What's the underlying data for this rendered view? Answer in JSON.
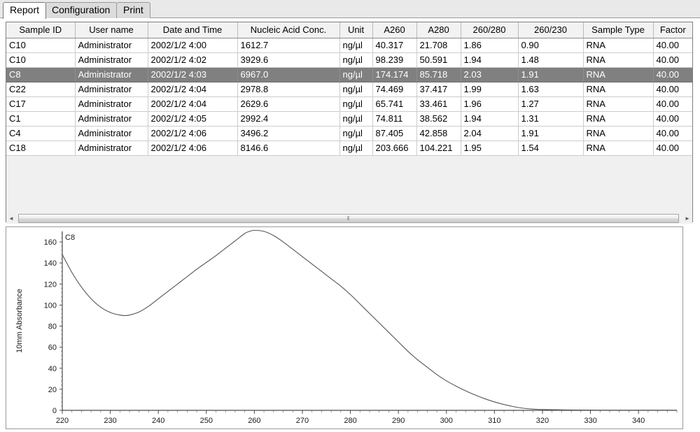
{
  "window": {
    "tabs": [
      {
        "id": "report",
        "label": "Report",
        "active": true
      },
      {
        "id": "configuration",
        "label": "Configuration",
        "active": false
      },
      {
        "id": "print",
        "label": "Print",
        "active": false
      }
    ]
  },
  "table": {
    "columns": [
      "Sample ID",
      "User name",
      "Date and Time",
      "Nucleic Acid Conc.",
      "Unit",
      "A260",
      "A280",
      "260/280",
      "260/230",
      "Sample Type",
      "Factor"
    ],
    "rows": [
      {
        "selected": false,
        "cells": [
          "C10",
          "Administrator",
          "2002/1/2 4:00",
          "1612.7",
          "ng/µl",
          "40.317",
          "21.708",
          "1.86",
          "0.90",
          "RNA",
          "40.00"
        ]
      },
      {
        "selected": false,
        "cells": [
          "C10",
          "Administrator",
          "2002/1/2 4:02",
          "3929.6",
          "ng/µl",
          "98.239",
          "50.591",
          "1.94",
          "1.48",
          "RNA",
          "40.00"
        ]
      },
      {
        "selected": true,
        "cells": [
          "C8",
          "Administrator",
          "2002/1/2 4:03",
          "6967.0",
          "ng/µl",
          "174.174",
          "85.718",
          "2.03",
          "1.91",
          "RNA",
          "40.00"
        ]
      },
      {
        "selected": false,
        "cells": [
          "C22",
          "Administrator",
          "2002/1/2 4:04",
          "2978.8",
          "ng/µl",
          "74.469",
          "37.417",
          "1.99",
          "1.63",
          "RNA",
          "40.00"
        ]
      },
      {
        "selected": false,
        "cells": [
          "C17",
          "Administrator",
          "2002/1/2 4:04",
          "2629.6",
          "ng/µl",
          "65.741",
          "33.461",
          "1.96",
          "1.27",
          "RNA",
          "40.00"
        ]
      },
      {
        "selected": false,
        "cells": [
          "C1",
          "Administrator",
          "2002/1/2 4:05",
          "2992.4",
          "ng/µl",
          "74.811",
          "38.562",
          "1.94",
          "1.31",
          "RNA",
          "40.00"
        ]
      },
      {
        "selected": false,
        "cells": [
          "C4",
          "Administrator",
          "2002/1/2 4:06",
          "3496.2",
          "ng/µl",
          "87.405",
          "42.858",
          "2.04",
          "1.91",
          "RNA",
          "40.00"
        ]
      },
      {
        "selected": false,
        "cells": [
          "C18",
          "Administrator",
          "2002/1/2 4:06",
          "8146.6",
          "ng/µl",
          "203.666",
          "104.221",
          "1.95",
          "1.54",
          "RNA",
          "40.00"
        ]
      }
    ]
  },
  "scrollbar": {
    "left_arrow": "◄",
    "right_arrow": "►",
    "grip": "⦀"
  },
  "chart_data": {
    "type": "line",
    "title": "",
    "series_label": "C8",
    "xlabel": "",
    "ylabel": "10mm Absorbance",
    "xlim": [
      220,
      348
    ],
    "ylim": [
      0,
      170
    ],
    "xticks": [
      220,
      230,
      240,
      250,
      260,
      270,
      280,
      290,
      300,
      310,
      320,
      330,
      340
    ],
    "yticks": [
      0,
      20,
      40,
      60,
      80,
      100,
      120,
      140,
      160
    ],
    "grid": false,
    "legend_position": "top-left-inside",
    "line_color": "#555555",
    "x": [
      220,
      222,
      224,
      226,
      228,
      230,
      232,
      233,
      234,
      236,
      238,
      240,
      242,
      244,
      246,
      248,
      250,
      252,
      254,
      256,
      258,
      259,
      260,
      262,
      264,
      266,
      268,
      270,
      272,
      274,
      276,
      278,
      280,
      282,
      284,
      286,
      288,
      290,
      292,
      294,
      296,
      298,
      300,
      302,
      304,
      306,
      308,
      310,
      312,
      314,
      316,
      318,
      320,
      325,
      330,
      335,
      340,
      345,
      348
    ],
    "y": [
      148,
      131,
      117,
      106,
      98,
      93,
      90.5,
      90,
      90.5,
      93.5,
      99,
      106,
      113,
      120,
      127,
      134,
      140.5,
      147,
      154,
      161,
      168,
      170,
      171,
      170,
      166,
      160,
      153,
      146,
      139,
      132,
      125,
      118,
      110,
      101,
      92,
      83,
      74,
      65,
      56,
      48,
      41,
      34,
      28,
      23,
      18.5,
      14.5,
      11,
      8,
      5.5,
      3.5,
      2,
      1.2,
      0.8,
      0.4,
      0.2,
      0.1,
      0.1,
      0.1,
      0.1
    ]
  }
}
